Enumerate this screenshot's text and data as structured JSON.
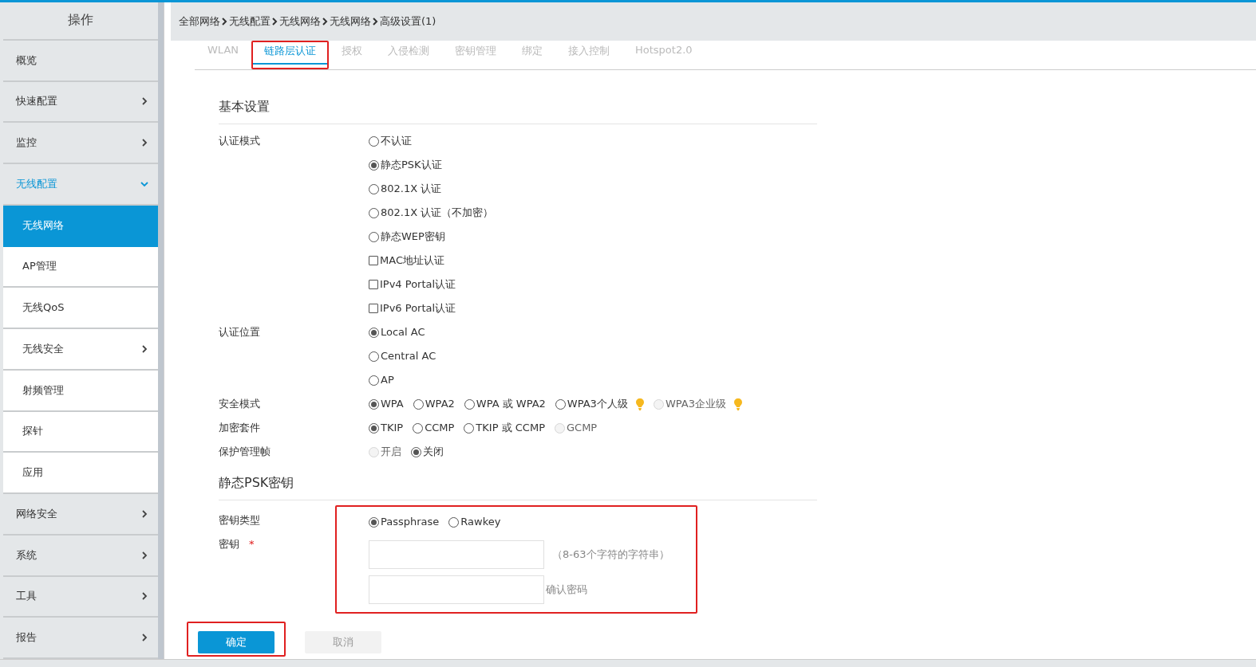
{
  "sidebar": {
    "title": "操作",
    "items": [
      {
        "label": "概览",
        "expandable": false,
        "expanded": false,
        "selected": false
      },
      {
        "label": "快速配置",
        "expandable": true,
        "expanded": false,
        "selected": false
      },
      {
        "label": "监控",
        "expandable": true,
        "expanded": false,
        "selected": false
      },
      {
        "label": "无线配置",
        "expandable": true,
        "expanded": true,
        "selected": false,
        "children": [
          {
            "label": "无线网络",
            "expandable": false,
            "selected": true
          },
          {
            "label": "AP管理",
            "expandable": false,
            "selected": false
          },
          {
            "label": "无线QoS",
            "expandable": false,
            "selected": false
          },
          {
            "label": "无线安全",
            "expandable": true,
            "selected": false
          },
          {
            "label": "射频管理",
            "expandable": false,
            "selected": false
          },
          {
            "label": "探针",
            "expandable": false,
            "selected": false
          },
          {
            "label": "应用",
            "expandable": false,
            "selected": false
          }
        ]
      },
      {
        "label": "网络安全",
        "expandable": true,
        "expanded": false,
        "selected": false
      },
      {
        "label": "系统",
        "expandable": true,
        "expanded": false,
        "selected": false
      },
      {
        "label": "工具",
        "expandable": true,
        "expanded": false,
        "selected": false
      },
      {
        "label": "报告",
        "expandable": true,
        "expanded": false,
        "selected": false
      }
    ]
  },
  "breadcrumb": [
    "全部网络",
    "无线配置",
    "无线网络",
    "无线网络",
    "高级设置(1)"
  ],
  "tabs": [
    {
      "label": "WLAN",
      "selected": false,
      "highlighted": false
    },
    {
      "label": "链路层认证",
      "selected": true,
      "highlighted": true
    },
    {
      "label": "授权",
      "selected": false,
      "highlighted": false
    },
    {
      "label": "入侵检测",
      "selected": false,
      "highlighted": false
    },
    {
      "label": "密钥管理",
      "selected": false,
      "highlighted": false
    },
    {
      "label": "绑定",
      "selected": false,
      "highlighted": false
    },
    {
      "label": "接入控制",
      "selected": false,
      "highlighted": false
    },
    {
      "label": "Hotspot2.0",
      "selected": false,
      "highlighted": false
    }
  ],
  "basic": {
    "heading": "基本设置",
    "fields": [
      {
        "label": "认证模式",
        "kind": "stack",
        "options": [
          {
            "kind": "radio",
            "label": "不认证",
            "selected": false,
            "disabled": false
          },
          {
            "kind": "radio",
            "label": "静态PSK认证",
            "selected": true,
            "disabled": false
          },
          {
            "kind": "radio",
            "label": "802.1X 认证",
            "selected": false,
            "disabled": false
          },
          {
            "kind": "radio",
            "label": "802.1X 认证（不加密）",
            "selected": false,
            "disabled": false
          },
          {
            "kind": "radio",
            "label": "静态WEP密钥",
            "selected": false,
            "disabled": false
          },
          {
            "kind": "checkbox",
            "label": "MAC地址认证",
            "checked": false,
            "disabled": false
          },
          {
            "kind": "checkbox",
            "label": "IPv4 Portal认证",
            "checked": false,
            "disabled": false
          },
          {
            "kind": "checkbox",
            "label": "IPv6 Portal认证",
            "checked": false,
            "disabled": false
          }
        ]
      },
      {
        "label": "认证位置",
        "kind": "stack",
        "options": [
          {
            "kind": "radio",
            "label": "Local AC",
            "selected": true,
            "disabled": false
          },
          {
            "kind": "radio",
            "label": "Central AC",
            "selected": false,
            "disabled": false
          },
          {
            "kind": "radio",
            "label": "AP",
            "selected": false,
            "disabled": false
          }
        ]
      },
      {
        "label": "安全模式",
        "kind": "inline",
        "options": [
          {
            "kind": "radio",
            "label": "WPA",
            "selected": true,
            "disabled": false,
            "tip": false
          },
          {
            "kind": "radio",
            "label": "WPA2",
            "selected": false,
            "disabled": false,
            "tip": false
          },
          {
            "kind": "radio",
            "label": "WPA 或 WPA2",
            "selected": false,
            "disabled": false,
            "tip": false
          },
          {
            "kind": "radio",
            "label": "WPA3个人级",
            "selected": false,
            "disabled": false,
            "tip": true
          },
          {
            "kind": "radio",
            "label": "WPA3企业级",
            "selected": false,
            "disabled": true,
            "tip": true
          }
        ]
      },
      {
        "label": "加密套件",
        "kind": "inline",
        "options": [
          {
            "kind": "radio",
            "label": "TKIP",
            "selected": true,
            "disabled": false
          },
          {
            "kind": "radio",
            "label": "CCMP",
            "selected": false,
            "disabled": false
          },
          {
            "kind": "radio",
            "label": "TKIP 或 CCMP",
            "selected": false,
            "disabled": false
          },
          {
            "kind": "radio",
            "label": "GCMP",
            "selected": false,
            "disabled": true
          }
        ]
      },
      {
        "label": "保护管理帧",
        "kind": "inline",
        "options": [
          {
            "kind": "radio",
            "label": "开启",
            "selected": false,
            "disabled": true
          },
          {
            "kind": "radio",
            "label": "关闭",
            "selected": true,
            "disabled": false
          }
        ]
      }
    ]
  },
  "psk": {
    "heading": "静态PSK密钥",
    "highlighted": true,
    "key_type": {
      "label": "密钥类型",
      "options": [
        {
          "kind": "radio",
          "label": "Passphrase",
          "selected": true,
          "disabled": false
        },
        {
          "kind": "radio",
          "label": "Rawkey",
          "selected": false,
          "disabled": false
        }
      ]
    },
    "key": {
      "label": "密钥",
      "required_mark": "*",
      "hint": "（8-63个字符的字符串）",
      "confirm_label": "确认密码"
    }
  },
  "buttons": [
    {
      "label": "确定",
      "kind": "primary",
      "highlighted": true
    },
    {
      "label": "取消",
      "kind": "secondary",
      "highlighted": false
    }
  ]
}
